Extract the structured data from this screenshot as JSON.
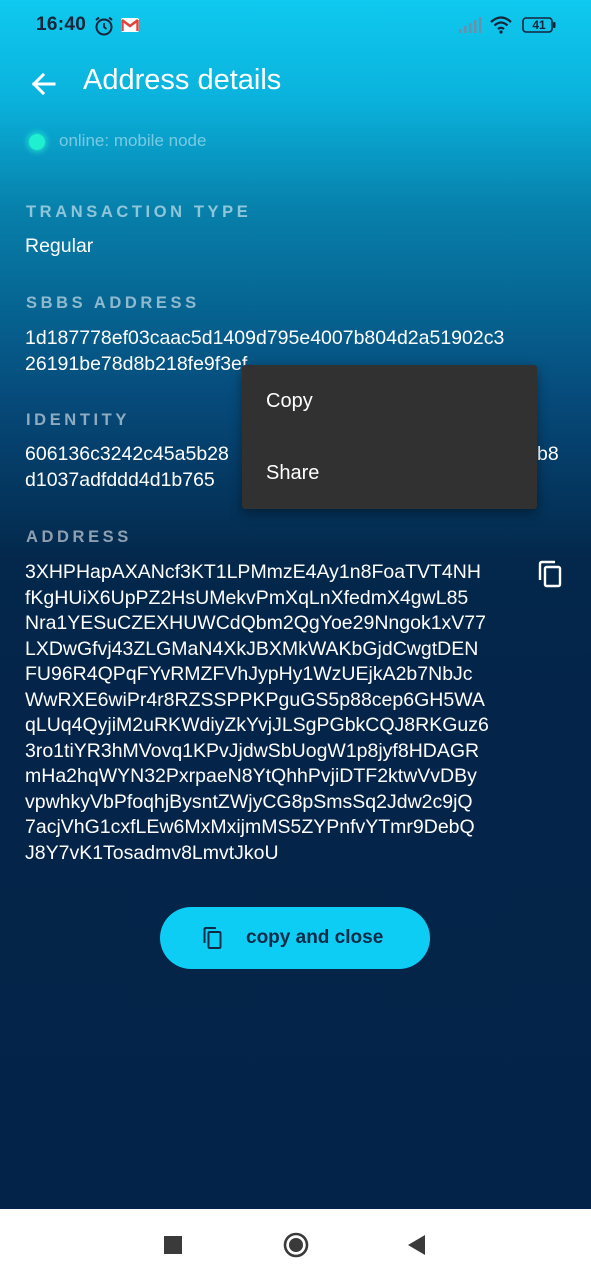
{
  "status_bar": {
    "time": "16:40",
    "battery": "41",
    "icons": [
      "alarm-icon",
      "gmail-icon",
      "signal-icon",
      "wifi-icon",
      "battery-icon"
    ]
  },
  "header": {
    "title": "Address details",
    "back_icon": "arrow-left-icon"
  },
  "connection": {
    "status_text": "online: mobile node",
    "dot_color": "#1ff0d0"
  },
  "details": {
    "transaction_type_label": "TRANSACTION TYPE",
    "transaction_type_value": "Regular",
    "sbbs_label": "SBBS ADDRESS",
    "sbbs_line1": "1d187778ef03caac5d1409d795e4007b804d2a51902c3",
    "sbbs_line2": "26191be78d8b218fe9f3ef",
    "identity_label": "IDENTITY",
    "identity_line1_start": "606136c3242c45a5b28",
    "identity_line1_end": "b8",
    "identity_line2": "d1037adfddd4d1b765",
    "address_label": "ADDRESS",
    "address_lines": [
      "3XHPHapAXANcf3KT1LPMmzE4Ay1n8FoaTVT4NH",
      "fKgHUiX6UpPZ2HsUMekvPmXqLnXfedmX4gwL85",
      "Nra1YESuCZEXHUWCdQbm2QgYoe29Nngok1xV77",
      "LXDwGfvj43ZLGMaN4XkJBXMkWAKbGjdCwgtDEN",
      "FU96R4QPqFYvRMZFVhJypHy1WzUEjkA2b7NbJc",
      "WwRXE6wiPr4r8RZSSPPKPguGS5p88cep6GH5WA",
      "qLUq4QyjiM2uRKWdiyZkYvjJLSgPGbkCQJ8RKGuz6",
      "3ro1tiYR3hMVovq1KPvJjdwSbUogW1p8jyf8HDAGR",
      "mHa2hqWYN32PxrpaeN8YtQhhPvjiDTF2ktwVvDBy",
      "vpwhkyVbPfoqhjBysntZWjyCG8pSmsSq2Jdw2c9jQ",
      "7acjVhG1cxfLEw6MxMxijmMS5ZYPnfvYTmr9DebQ",
      "J8Y7vK1Tosadmv8LmvtJkoU"
    ]
  },
  "actions": {
    "copy_and_close": "copy and close",
    "accent": "#0dcdf5"
  },
  "context_menu": {
    "items": [
      "Copy",
      "Share"
    ]
  }
}
